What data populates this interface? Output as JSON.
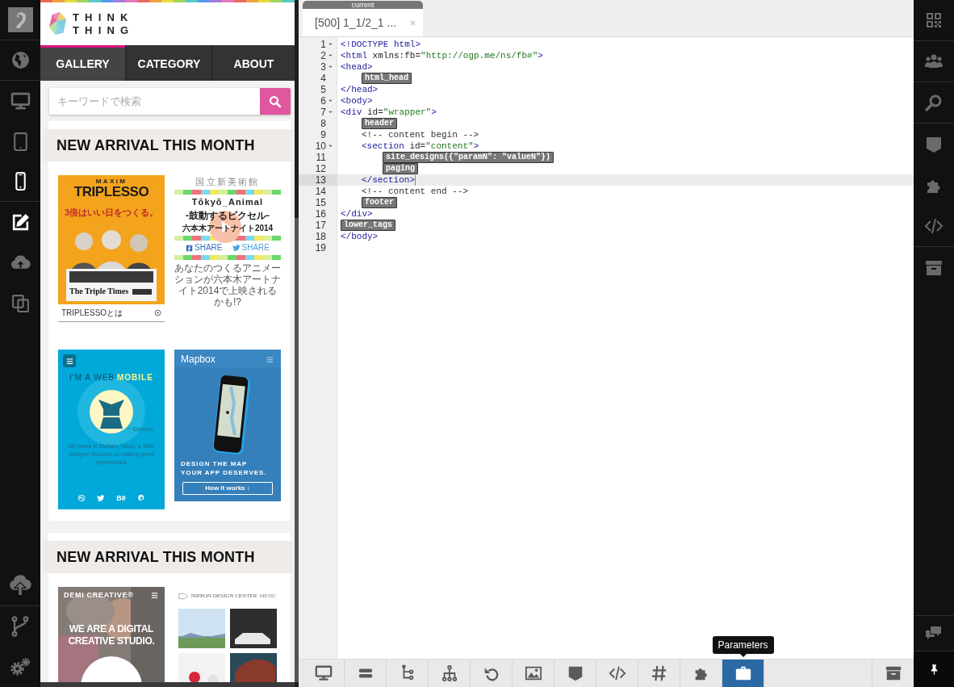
{
  "sidebar": {
    "items": [
      {
        "selected": false
      },
      {
        "selected": false
      },
      {
        "selected": false
      },
      {
        "selected": true
      },
      {
        "selected": true
      },
      {
        "selected": false
      },
      {
        "selected": false
      }
    ]
  },
  "preview": {
    "logo": {
      "line_1": "THINK",
      "line_2": "THING"
    },
    "nav": [
      {
        "label": "GALLERY",
        "selected": true
      },
      {
        "label": "CATEGORY",
        "selected": false
      },
      {
        "label": "ABOUT",
        "selected": false
      }
    ],
    "search": {
      "placeholder": "キーワードで検索"
    },
    "sections": [
      {
        "heading": "NEW ARRIVAL THIS MONTH",
        "thumbnails": [
          {
            "kind": "poster",
            "texts": [
              "MAXIM",
              "TRIPLESSO",
              "3倍はいい日をつくる。",
              "The Triple Times",
              "TRIPLESSOとは"
            ]
          },
          {
            "kind": "event",
            "texts": [
              "国立新美術館",
              "Tōkyō_Animal",
              "-鼓動するピクセル-",
              "六本木アートナイト2014",
              "SHARE",
              "SHARE",
              "あなたのつくるアニメーションが六本木アートナイト2014で上映されるかも!?"
            ]
          },
          {
            "kind": "portfolio",
            "texts": [
              "I'M A WEB",
              "MOBILE",
              "* Samurai",
              "My name is Stefano Tirloni, a Web designer focused on crafting great experiences.",
              "Bē"
            ]
          },
          {
            "kind": "app",
            "texts": [
              "Mapbox",
              "DESIGN THE MAP",
              "YOUR APP DESERVES.",
              "How it works ↓"
            ]
          }
        ]
      },
      {
        "heading": "NEW ARRIVAL THIS MONTH",
        "thumbnails": [
          {
            "kind": "studio",
            "texts": [
              "DEMI CREATIVE®",
              "WE ARE A DIGITAL",
              "CREATIVE STUDIO."
            ]
          },
          {
            "kind": "gallery",
            "texts": [
              "NIPPON DESIGN CENTER",
              "MENU"
            ]
          }
        ]
      }
    ]
  },
  "editor": {
    "tab": {
      "caption": "current",
      "title": "[500] 1_1/2_1 ...",
      "selected": true
    },
    "lines": [
      {
        "num": "1",
        "fold": true,
        "active": false,
        "parts": [
          {
            "kind": "tag",
            "text": "<!DOCTYPE html>"
          }
        ]
      },
      {
        "num": "2",
        "fold": true,
        "active": false,
        "parts": [
          {
            "kind": "tag",
            "text": "<html"
          },
          {
            "kind": "attr",
            "text": " xmlns:fb="
          },
          {
            "kind": "value",
            "text": "\"http://ogp.me/ns/fb#\""
          },
          {
            "kind": "tag",
            "text": ">"
          }
        ]
      },
      {
        "num": "3",
        "fold": true,
        "active": false,
        "parts": [
          {
            "kind": "tag",
            "text": "<head>"
          }
        ]
      },
      {
        "num": "4",
        "fold": false,
        "active": false,
        "kind": "inner",
        "parts": [
          {
            "kind": "widget",
            "text": "html_head"
          }
        ]
      },
      {
        "num": "5",
        "fold": false,
        "active": false,
        "parts": [
          {
            "kind": "tag",
            "text": "</head>"
          }
        ]
      },
      {
        "num": "6",
        "fold": true,
        "active": false,
        "parts": [
          {
            "kind": "tag",
            "text": "<body>"
          }
        ]
      },
      {
        "num": "7",
        "fold": true,
        "active": false,
        "parts": [
          {
            "kind": "tag",
            "text": "<div"
          },
          {
            "kind": "attr",
            "text": " id="
          },
          {
            "kind": "value",
            "text": "\"wrapper\""
          },
          {
            "kind": "tag",
            "text": ">"
          }
        ]
      },
      {
        "num": "8",
        "fold": false,
        "active": false,
        "kind": "inner",
        "parts": [
          {
            "kind": "widget",
            "text": "header"
          }
        ]
      },
      {
        "num": "9",
        "fold": false,
        "active": false,
        "kind": "inner",
        "parts": [
          {
            "kind": "comment",
            "text": "<!-- content begin -->"
          }
        ]
      },
      {
        "num": "10",
        "fold": true,
        "active": false,
        "kind": "inner",
        "parts": [
          {
            "kind": "tag",
            "text": "<section"
          },
          {
            "kind": "attr",
            "text": " id="
          },
          {
            "kind": "value",
            "text": "\"content\""
          },
          {
            "kind": "tag",
            "text": ">"
          }
        ]
      },
      {
        "num": "11",
        "fold": false,
        "active": false,
        "kind": "deep",
        "parts": [
          {
            "kind": "widget",
            "text": "site_designs({\"paramN\": \"valueN\"})"
          }
        ]
      },
      {
        "num": "12",
        "fold": false,
        "active": false,
        "kind": "deep",
        "parts": [
          {
            "kind": "widget",
            "text": "paging"
          }
        ]
      },
      {
        "num": "13",
        "fold": false,
        "active": true,
        "kind": "inner",
        "parts": [
          {
            "kind": "tag",
            "text": "</section>"
          }
        ]
      },
      {
        "num": "14",
        "fold": false,
        "active": false,
        "kind": "inner",
        "parts": [
          {
            "kind": "comment",
            "text": "<!-- content end -->"
          }
        ]
      },
      {
        "num": "15",
        "fold": false,
        "active": false,
        "kind": "inner",
        "parts": [
          {
            "kind": "widget",
            "text": "footer"
          }
        ]
      },
      {
        "num": "16",
        "fold": false,
        "active": false,
        "parts": [
          {
            "kind": "tag",
            "text": "</div>"
          }
        ]
      },
      {
        "num": "17",
        "fold": false,
        "active": false,
        "parts": [
          {
            "kind": "widget",
            "text": "lower_tags"
          }
        ]
      },
      {
        "num": "18",
        "fold": false,
        "active": false,
        "parts": [
          {
            "kind": "tag",
            "text": "</body>"
          }
        ]
      },
      {
        "num": "19",
        "fold": false,
        "active": false
      }
    ]
  },
  "toolbar": {
    "tools": [
      {
        "selected": false
      },
      {
        "selected": false
      },
      {
        "selected": false
      },
      {
        "selected": false
      },
      {
        "selected": false
      },
      {
        "selected": false
      },
      {
        "selected": false
      },
      {
        "selected": false
      },
      {
        "selected": false
      },
      {
        "selected": false
      },
      {
        "selected": true
      }
    ],
    "tooltip": "Parameters"
  }
}
